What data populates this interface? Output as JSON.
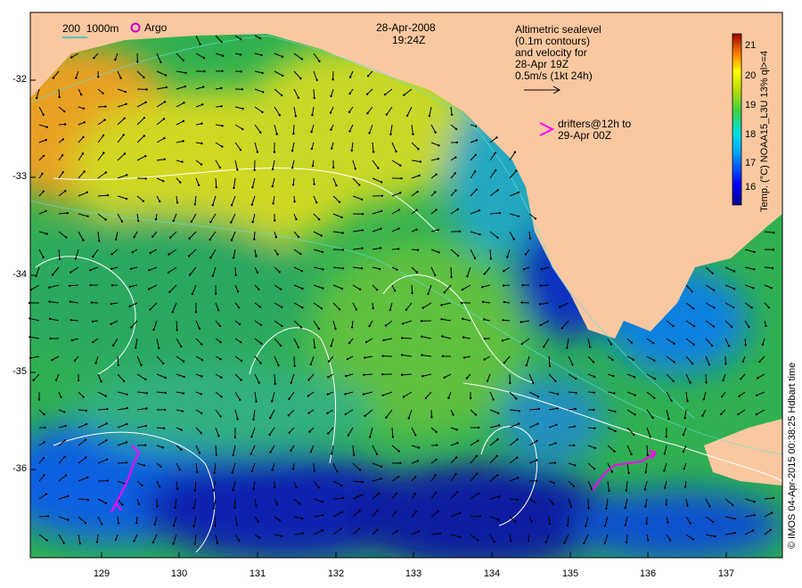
{
  "map": {
    "date": "28-Apr-2008",
    "time": "19:24Z",
    "bathy_legend": "200  1000m",
    "argo_label": "Argo",
    "altimetry_note": [
      "Altimetric sealevel",
      "(0.1m contours)",
      "and velocity for",
      "28-Apr 19Z",
      "0.5m/s (1kt 24h)"
    ],
    "drifter_note": [
      "drifters@12h to",
      "29-Apr 00Z"
    ],
    "colorbar_label": "Temp. (°C) NOAA15_L3U 13% ql>=4",
    "credit": "© IMOS 04-Apr-2015 00:38:25 Hdbart time",
    "colors": {
      "land": "#fac8a0",
      "drifter": "#ff00ff",
      "contour": "#ffffff",
      "arrow": "#000000"
    }
  },
  "axes": {
    "lat_ticks": [
      "-32",
      "-33",
      "-34",
      "-35",
      "-36"
    ],
    "lon_ticks": [
      "129",
      "130",
      "131",
      "132",
      "133",
      "134",
      "135",
      "136",
      "137"
    ]
  },
  "colorbar": {
    "ticks": [
      "21",
      "20",
      "19",
      "18",
      "17",
      "16"
    ],
    "min": 15.2,
    "max": 21.6
  }
}
